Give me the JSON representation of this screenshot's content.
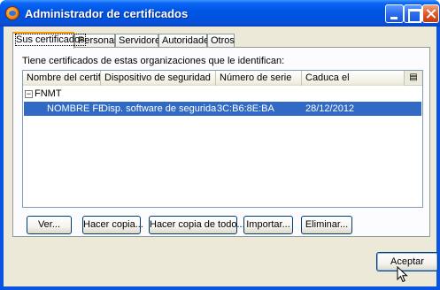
{
  "window": {
    "title": "Administrador de certificados"
  },
  "tabs": [
    {
      "label": "Sus certificados",
      "active": true
    },
    {
      "label": "Personas",
      "active": false
    },
    {
      "label": "Servidores",
      "active": false
    },
    {
      "label": "Autoridades",
      "active": false
    },
    {
      "label": "Otros",
      "active": false
    }
  ],
  "panel": {
    "intro": "Tiene certificados de estas organizaciones que le identifican:"
  },
  "tree": {
    "columns": [
      "Nombre del certifi...",
      "Dispositivo de seguridad",
      "Número de serie",
      "Caduca el"
    ],
    "group": {
      "expander": "⊟",
      "name": "FNMT"
    },
    "rows": [
      {
        "name": "NOMBRE FER...",
        "device": "Disp. software de seguridad",
        "serial": "3C:B6:8E:BA",
        "expires": "28/12/2012"
      }
    ],
    "column_picker_icon": "▤"
  },
  "buttons": {
    "ver": "Ver...",
    "hacer_copia": "Hacer copia...",
    "hacer_copia_todo": "Hacer copia de todo...",
    "importar": "Importar...",
    "eliminar": "Eliminar...",
    "aceptar": "Aceptar"
  },
  "colors": {
    "titlebar": "#0055e5",
    "selection": "#316ac5",
    "dialog_bg": "#ece9d8",
    "tab_accent": "#ff9a00"
  }
}
